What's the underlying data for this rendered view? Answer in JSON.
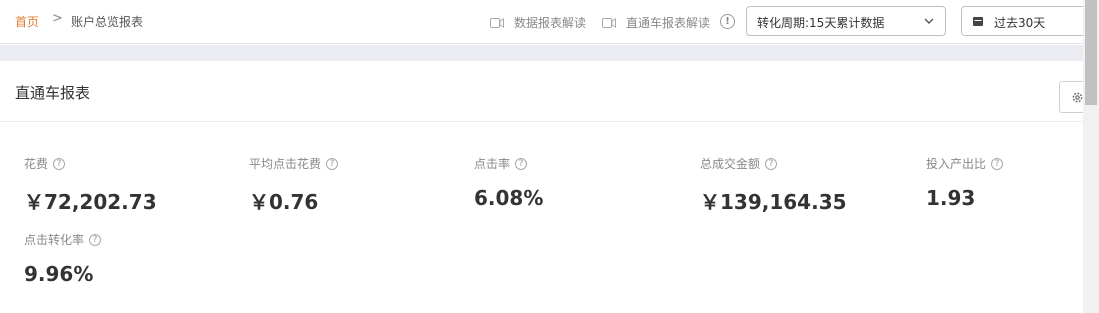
{
  "breadcrumb": {
    "home": "首页",
    "separator": ">",
    "current": "账户总览报表"
  },
  "guides": [
    {
      "label": "数据报表解读",
      "icon": "video-icon"
    },
    {
      "label": "直通车报表解读",
      "icon": "video-icon"
    }
  ],
  "period_select": {
    "value": "转化周期:15天累计数据",
    "icon": "chevron-down-icon"
  },
  "date_select": {
    "value": "过去30天",
    "icon": "calendar-icon"
  },
  "card": {
    "title": "直通车报表",
    "settings_icon": "gear-icon"
  },
  "metrics": [
    {
      "label": "花费",
      "value": "￥72,202.73"
    },
    {
      "label": "平均点击花费",
      "value": "￥0.76"
    },
    {
      "label": "点击率",
      "value": "6.08%"
    },
    {
      "label": "总成交金额",
      "value": "￥139,164.35"
    },
    {
      "label": "投入产出比",
      "value": "1.93"
    },
    {
      "label": "点击转化率",
      "value": "9.96%"
    }
  ],
  "colors": {
    "accent": "#e27d31",
    "background_gap": "#ebebf2",
    "text": "#333333",
    "muted": "#888888"
  }
}
